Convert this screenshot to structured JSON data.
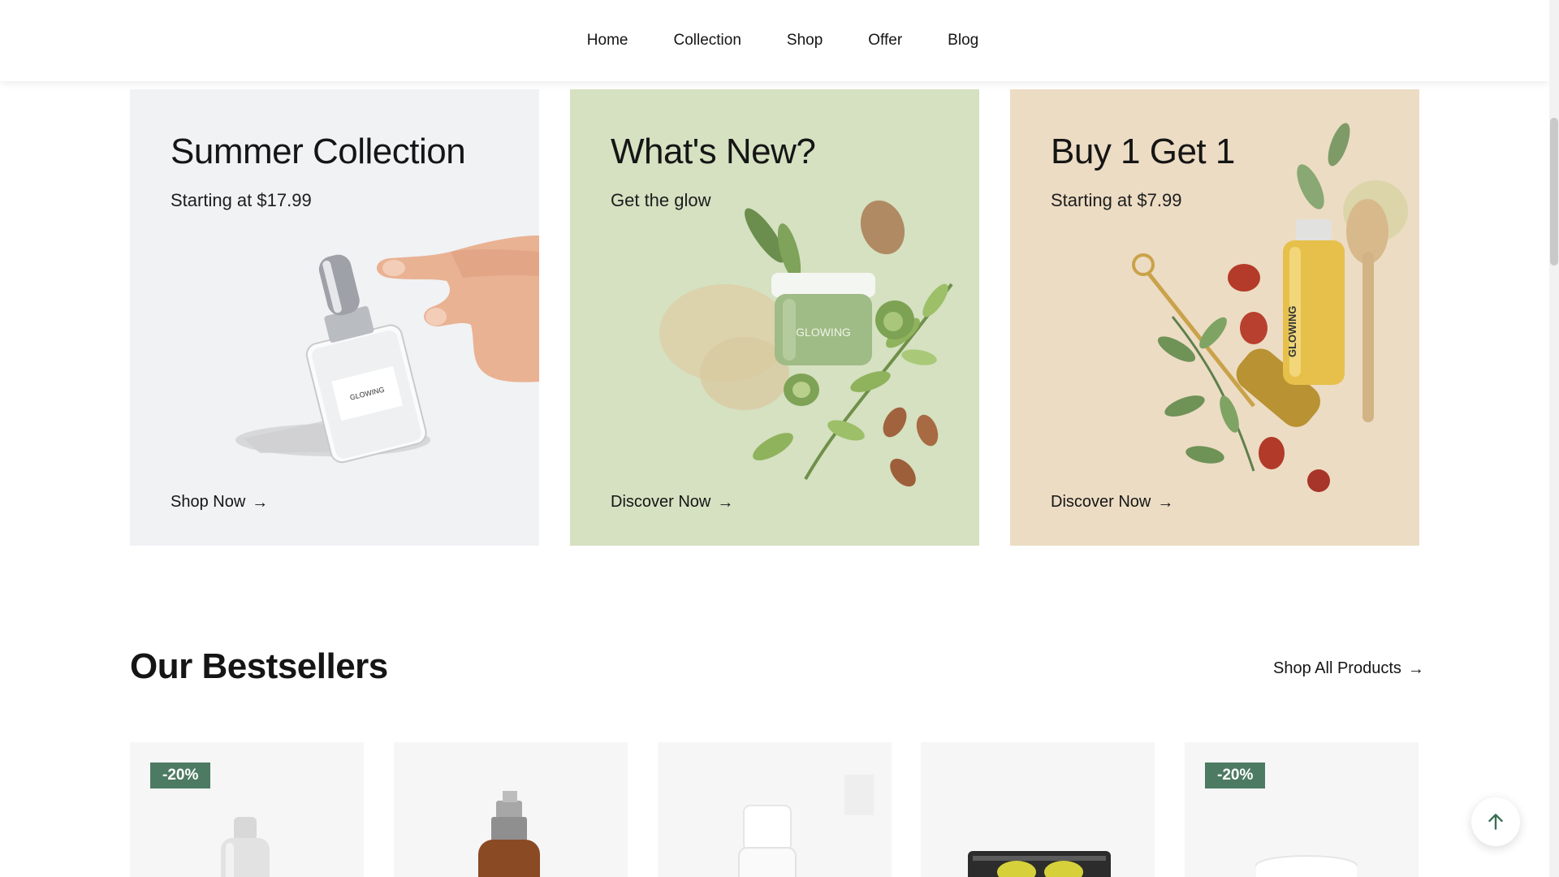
{
  "nav": {
    "items": [
      {
        "label": "Home"
      },
      {
        "label": "Collection"
      },
      {
        "label": "Shop"
      },
      {
        "label": "Offer"
      },
      {
        "label": "Blog"
      }
    ]
  },
  "promos": [
    {
      "title": "Summer Collection",
      "subtitle": "Starting at $17.99",
      "link": "Shop Now",
      "link_icon": "arrow-right-icon",
      "bg": "#f1f2f4"
    },
    {
      "title": "What's New?",
      "subtitle": "Get the glow",
      "link": "Discover Now",
      "link_icon": "arrow-right-icon",
      "bg": "#d5e1c1"
    },
    {
      "title": "Buy 1 Get 1",
      "subtitle": "Starting at $7.99",
      "link": "Discover Now",
      "link_icon": "arrow-right-icon",
      "bg": "#ecdcc3"
    }
  ],
  "product_brand": "GLOWING",
  "bestsellers": {
    "title": "Our Bestsellers",
    "shop_all": "Shop All Products",
    "products": [
      {
        "badge": "-20%"
      },
      {
        "badge": ""
      },
      {
        "badge": ""
      },
      {
        "badge": ""
      },
      {
        "badge": "-20%"
      }
    ]
  },
  "colors": {
    "badge": "#4d7a62",
    "accent_green": "#4d7a62",
    "text": "#151515"
  },
  "icons": {
    "back_to_top": "arrow-up-icon"
  }
}
